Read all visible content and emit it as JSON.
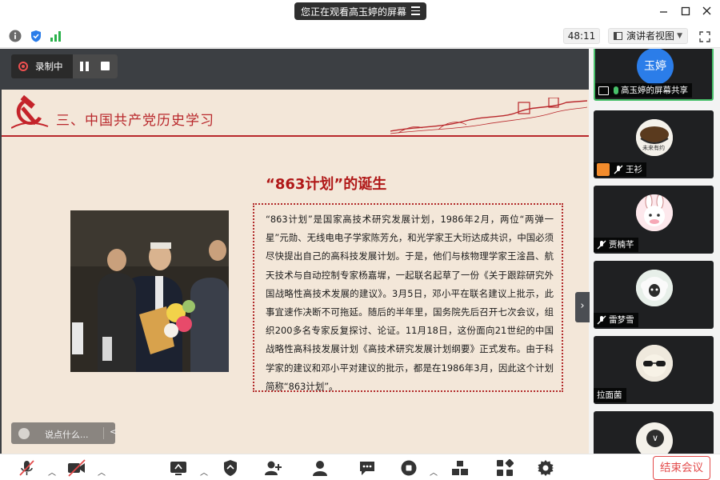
{
  "title_bar": {
    "viewing_label": "您正在观看高玉婷的屏幕"
  },
  "toolbar": {
    "timer": "48:11",
    "view_mode": "演讲者视图"
  },
  "recording": {
    "label": "录制中"
  },
  "slide": {
    "section_title": "三、中国共产党历史学习",
    "heading": "“863计划”的诞生",
    "body": "“863计划”是国家高技术研究发展计划，1986年2月，两位“两弹一星”元勋、无线电电子学家陈芳允，和光学家王大珩达成共识，中国必须尽快提出自己的高科技发展计划。于是，他们与核物理学家王淦昌、航天技术与自动控制专家杨嘉墀，一起联名起草了一份《关于跟踪研究外国战略性高技术发展的建议》。3月5日，邓小平在联名建议上批示，此事宜速作决断不可拖延。随后的半年里，国务院先后召开七次会议，组织200多名专家反复探讨、论证。11月18日，这份面向21世纪的中国战略性高科技发展计划《高技术研究发展计划纲要》正式发布。由于科学家的建议和邓小平对建议的批示，都是在1986年3月，因此这个计划简称“863计划”。"
  },
  "chat": {
    "placeholder": "说点什么..."
  },
  "participants": [
    {
      "name": "高玉婷的屏幕共享",
      "avatar_text": "玉婷",
      "avatar_color": "#2b7de9",
      "mic": "on",
      "active": true
    },
    {
      "name": "王衫",
      "mic": "off",
      "has_badge": true
    },
    {
      "name": "贾楠芊",
      "mic": "off"
    },
    {
      "name": "雷梦雪",
      "mic": "off"
    },
    {
      "name": "拉面菌",
      "mic": "none"
    }
  ],
  "controls": {
    "end_meeting": "结束会议"
  },
  "colors": {
    "accent_red": "#b9282c",
    "active_green": "#48c06a",
    "end_red": "#e34a4a"
  }
}
